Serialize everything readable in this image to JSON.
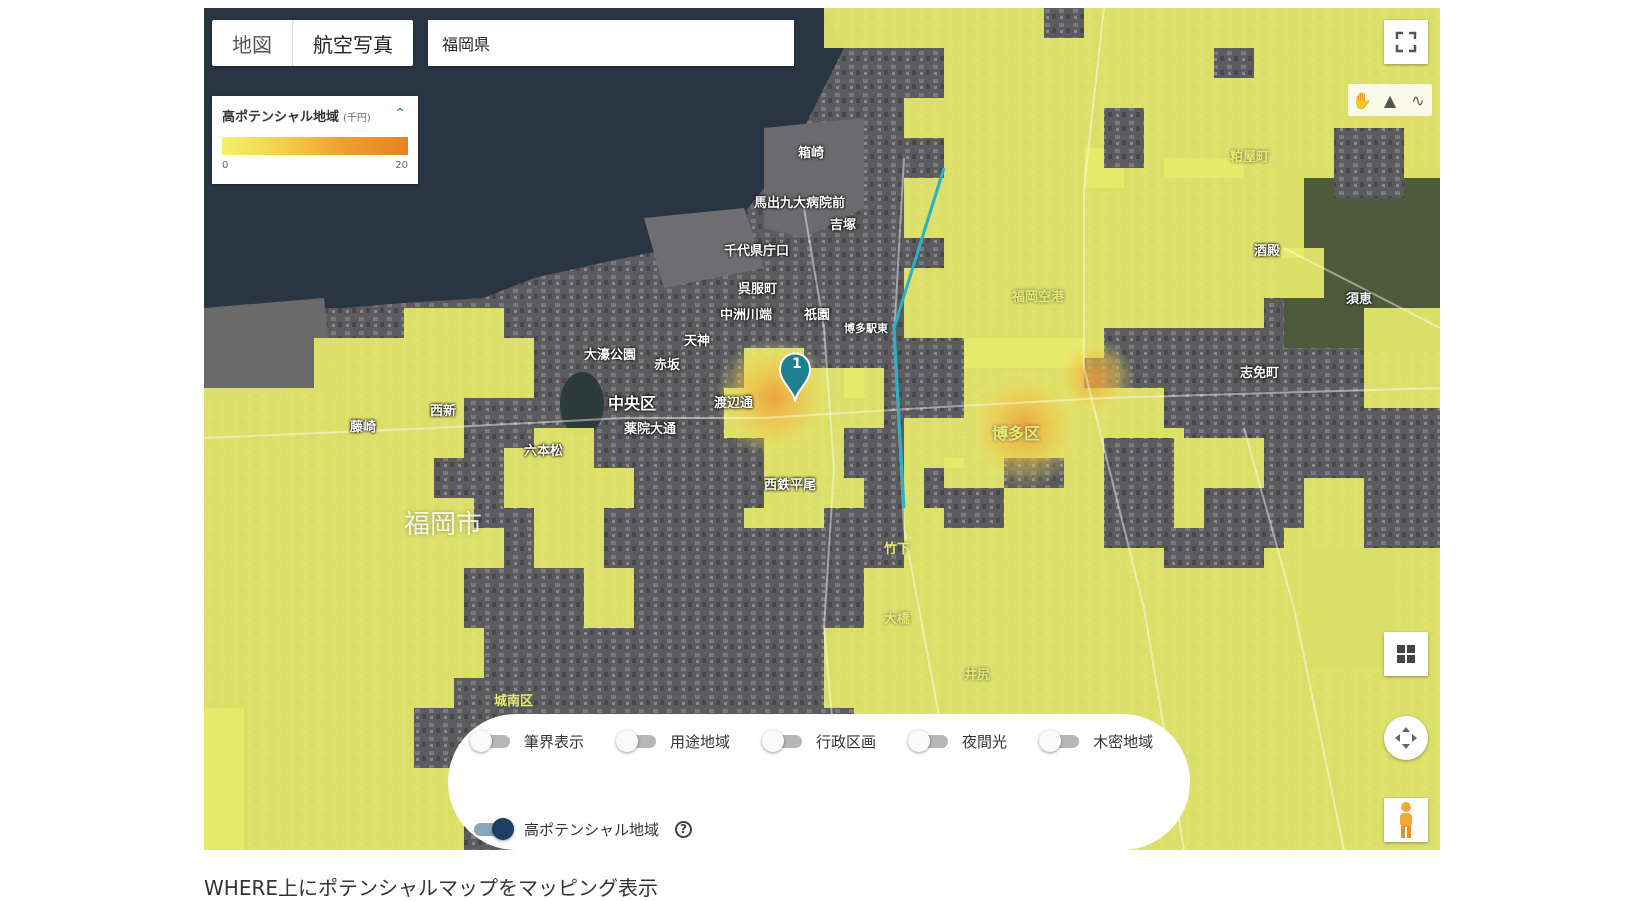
{
  "map": {
    "type_buttons": [
      "地図",
      "航空写真"
    ],
    "active_type": "航空写真",
    "search_value": "福岡県",
    "legend": {
      "title": "高ポテンシャル地域",
      "unit": "(千円)",
      "min": "0",
      "max": "20",
      "colors": [
        "#f3f26a",
        "#f2cf4a",
        "#ee9e2e",
        "#e8821f"
      ]
    },
    "marker_label": "1",
    "place_labels": {
      "fukuoka_city": "福岡市",
      "chuo_ku": "中央区",
      "hakata_ku": "博多区",
      "tenjin": "天神",
      "nakasu": "中洲川端",
      "gofukumachi": "呉服町",
      "gion": "祇園",
      "hakozaki": "箱崎",
      "hakata_station": "博多駅東",
      "fukuoka_airport": "福岡空港",
      "shime": "志免町",
      "sakedo": "酒殿",
      "sue": "須恵",
      "kasuya": "粕屋町",
      "nishijin": "西新",
      "fujisaki": "藤崎",
      "ropponmatsu": "六本松",
      "yakuin": "薬院大通",
      "akasaka": "赤坂",
      "ohori": "大濠公園",
      "chiyo": "千代県庁口",
      "maidashi": "馬出九大病院前",
      "yoshizuka": "吉塚",
      "watanabe": "渡辺通",
      "nishitetsu_hirao": "西鉄平尾",
      "takeshita": "竹下",
      "ohashi": "大橋",
      "izuru": "井尻",
      "minami_ku": "城南区"
    },
    "colors": {
      "highlight": "#e8ec6d",
      "water": "#2a3744",
      "urban": "#5f5f62",
      "marker": "#1e7f8e"
    }
  },
  "controls": {
    "fullscreen_icon": "fullscreen-icon",
    "draw_tools": [
      "hand-icon",
      "polygon-icon",
      "line-icon"
    ],
    "layers_icon": "grid-icon",
    "pan_icon": "pan-icon",
    "pegman_icon": "pegman-icon"
  },
  "layers_panel": {
    "toggles": [
      {
        "label": "筆界表示",
        "on": false
      },
      {
        "label": "用途地域",
        "on": false
      },
      {
        "label": "行政区画",
        "on": false
      },
      {
        "label": "夜間光",
        "on": false
      },
      {
        "label": "木密地域",
        "on": false
      }
    ],
    "potential_toggle": {
      "label": "高ポテンシャル地域",
      "on": true
    },
    "help": "?"
  },
  "caption": "WHERE上にポテンシャルマップをマッピング表示"
}
